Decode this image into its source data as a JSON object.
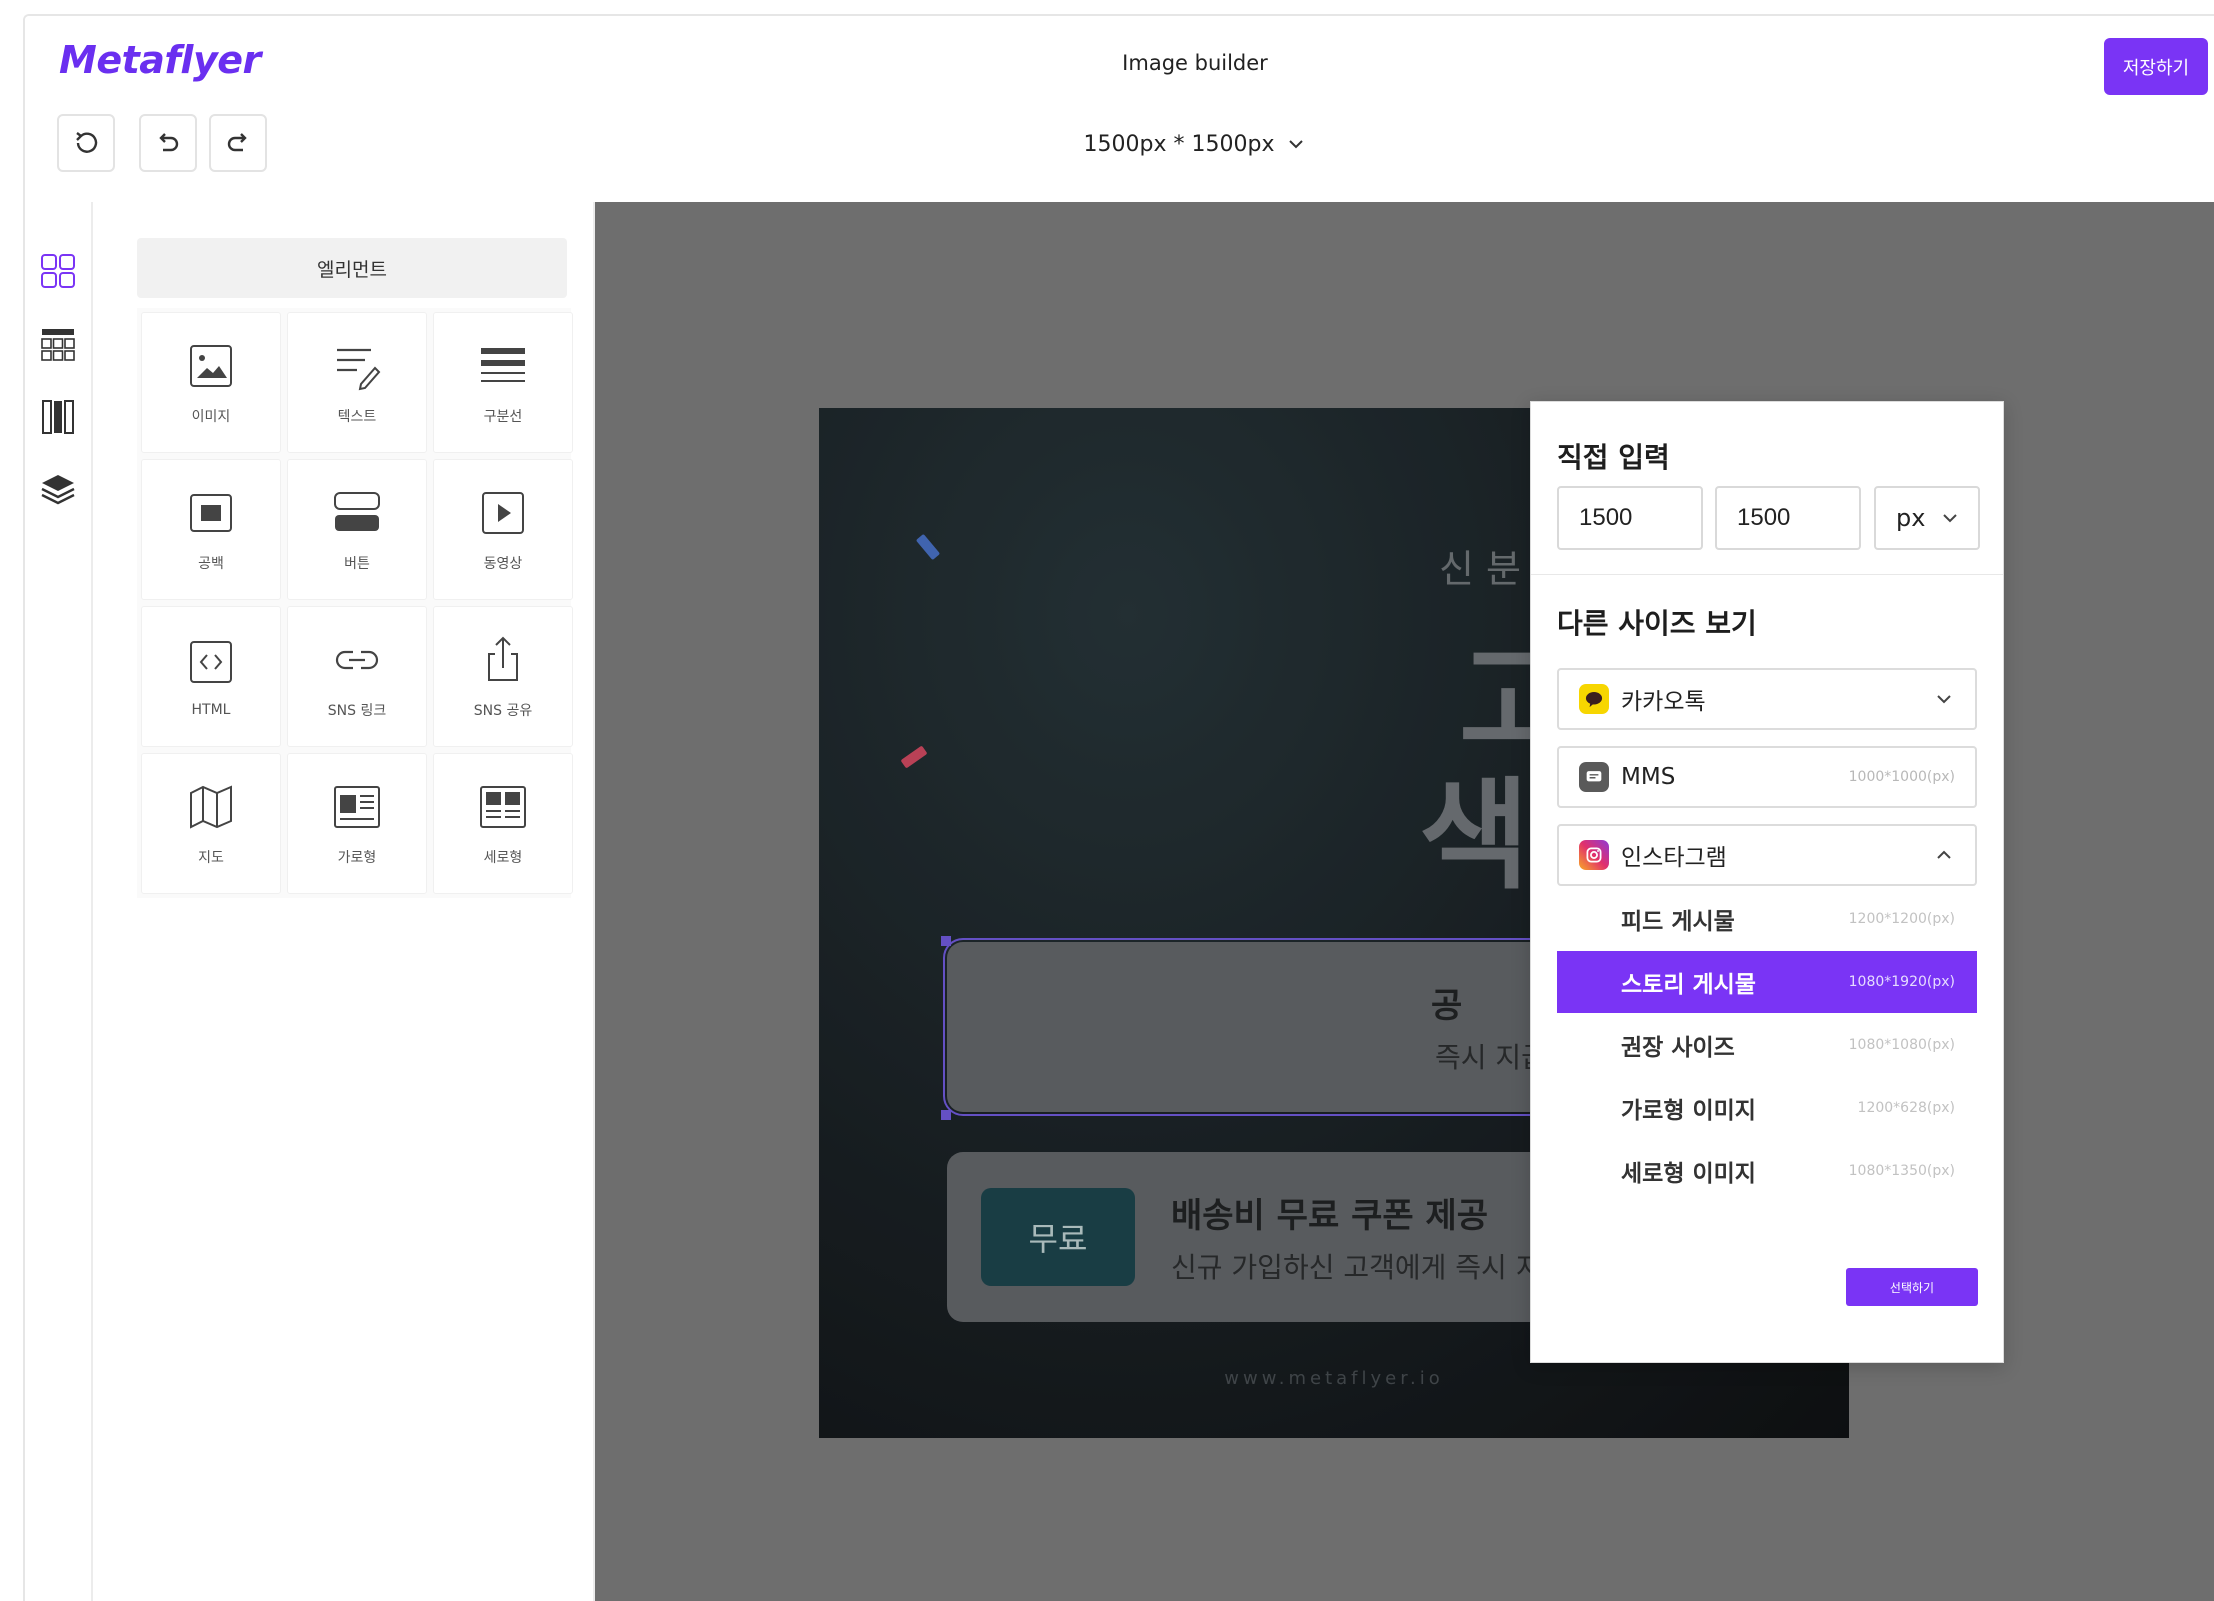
{
  "app": {
    "logo_text": "Metaflyer",
    "title": "Image builder",
    "save_label": "저장하기",
    "canvas_size": "1500px * 1500px"
  },
  "colors": {
    "accent": "#7a34f5",
    "kakao": "#f7d600",
    "instagram": "#e1306c"
  },
  "panel": {
    "title": "엘리먼트",
    "items": [
      {
        "label": "이미지",
        "icon": "image-icon"
      },
      {
        "label": "텍스트",
        "icon": "text-edit-icon"
      },
      {
        "label": "구분선",
        "icon": "divider-icon"
      },
      {
        "label": "공백",
        "icon": "spacer-icon"
      },
      {
        "label": "버튼",
        "icon": "button-icon"
      },
      {
        "label": "동영상",
        "icon": "video-icon"
      },
      {
        "label": "HTML",
        "icon": "code-icon"
      },
      {
        "label": "SNS 링크",
        "icon": "link-icon"
      },
      {
        "label": "SNS 공유",
        "icon": "share-icon"
      },
      {
        "label": "지도",
        "icon": "map-icon"
      },
      {
        "label": "가로형",
        "icon": "horizontal-layout-icon"
      },
      {
        "label": "세로형",
        "icon": "vertical-layout-icon"
      }
    ]
  },
  "artboard": {
    "subtitle_partial": "신 분 누구나",
    "headline_partial_1": "고객",
    "headline_partial_2": "색 – !",
    "card1": {
      "title_partial": "공",
      "desc_partial": "즉시 지급해드려요"
    },
    "card2": {
      "badge": "무료",
      "title": "배송비 무료 쿠폰 제공",
      "desc": "신규 가입하신 고객에게 즉시 지급해드려요"
    },
    "footer_url": "www.metaflyer.io"
  },
  "size_popover": {
    "direct_input_title": "직접 입력",
    "width_value": "1500",
    "height_value": "1500",
    "unit": "px",
    "other_sizes_title": "다른 사이즈 보기",
    "groups": [
      {
        "label": "카카오톡",
        "icon": "kakaotalk-icon",
        "expanded": false
      },
      {
        "label": "MMS",
        "icon": "message-icon",
        "size": "1000*1000(px)"
      },
      {
        "label": "인스타그램",
        "icon": "instagram-icon",
        "expanded": true
      }
    ],
    "instagram_options": [
      {
        "label": "피드 게시물",
        "size": "1200*1200(px)",
        "active": false
      },
      {
        "label": "스토리 게시물",
        "size": "1080*1920(px)",
        "active": true
      },
      {
        "label": "권장 사이즈",
        "size": "1080*1080(px)",
        "active": false
      },
      {
        "label": "가로형 이미지",
        "size": "1200*628(px)",
        "active": false
      },
      {
        "label": "세로형 이미지",
        "size": "1080*1350(px)",
        "active": false
      }
    ],
    "select_label": "선택하기"
  }
}
